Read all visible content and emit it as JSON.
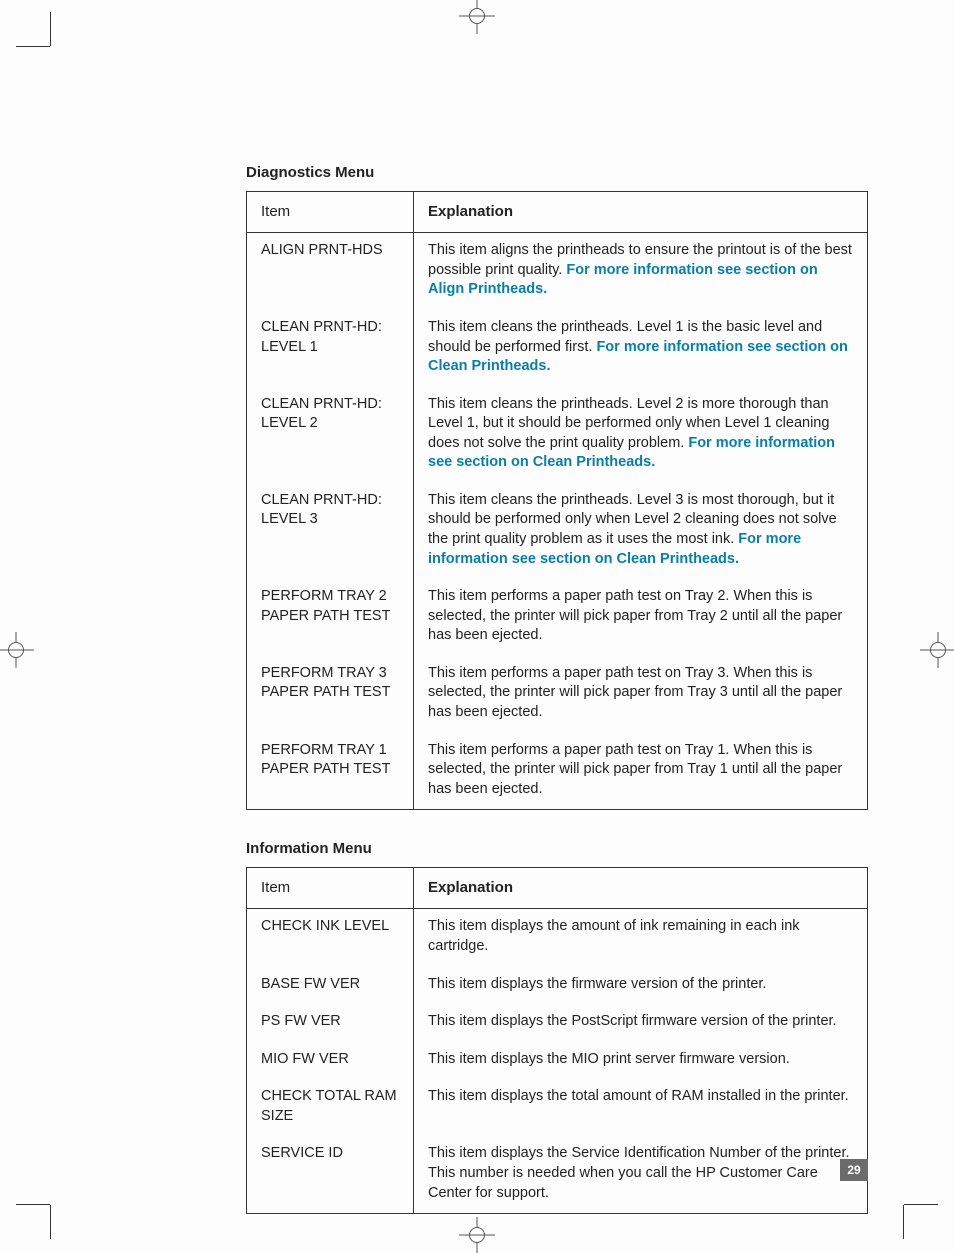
{
  "sections": [
    {
      "title": "Diagnostics Menu",
      "headers": {
        "item": "Item",
        "explanation": "Explanation"
      },
      "rows": [
        {
          "item": "ALIGN PRNT-HDS",
          "text": "This item aligns the printheads to ensure the printout is of the best possible print quality. ",
          "link": "For more information see section on Align Printheads."
        },
        {
          "item": "CLEAN PRNT-HD: LEVEL 1",
          "text": "This item cleans the printheads. Level 1 is the basic level and should be performed first. ",
          "link": "For more information see section on Clean Printheads."
        },
        {
          "item": "CLEAN PRNT-HD: LEVEL 2",
          "text": "This item cleans the printheads. Level 2 is more thorough than Level 1, but it should be performed only when Level 1 cleaning does not solve the print quality problem. ",
          "link": "For more information see section on Clean Printheads."
        },
        {
          "item": "CLEAN PRNT-HD: LEVEL 3",
          "text": "This item cleans the printheads. Level 3 is most thorough, but it should be performed only when Level 2 cleaning does not solve the print quality problem as it uses the most ink. ",
          "link": "For more information see section on Clean Printheads."
        },
        {
          "item": "PERFORM TRAY 2 PAPER PATH TEST",
          "text": "This item performs a paper path test on Tray 2. When this is selected, the printer will pick paper from Tray 2 until all the paper has been ejected.",
          "link": ""
        },
        {
          "item": "PERFORM TRAY 3 PAPER PATH TEST",
          "text": "This item performs a paper path test on Tray 3. When this is selected, the printer will pick paper from Tray 3 until all the paper has been ejected.",
          "link": ""
        },
        {
          "item": "PERFORM TRAY 1 PAPER PATH TEST",
          "text": "This item performs a paper path test on Tray 1. When this is selected, the printer will pick paper from Tray 1 until all the paper has been ejected.",
          "link": ""
        }
      ]
    },
    {
      "title": "Information Menu",
      "headers": {
        "item": "Item",
        "explanation": "Explanation"
      },
      "rows": [
        {
          "item": "CHECK INK LEVEL",
          "text": "This item displays the amount of ink remaining in each ink cartridge.",
          "link": ""
        },
        {
          "item": "BASE FW VER",
          "text": "This item displays the firmware version of the printer.",
          "link": ""
        },
        {
          "item": "PS FW VER",
          "text": "This item displays the PostScript firmware version of the printer.",
          "link": ""
        },
        {
          "item": "MIO FW VER",
          "text": "This item displays the MIO print server firmware version.",
          "link": ""
        },
        {
          "item": "CHECK TOTAL RAM SIZE",
          "text": "This item displays the total amount of RAM installed in the printer.",
          "link": ""
        },
        {
          "item": "SERVICE ID",
          "text": "This item displays the Service Identification Number of the printer. This number is needed when you call the HP Customer Care Center for support.",
          "link": ""
        }
      ]
    }
  ],
  "page_number": "29"
}
